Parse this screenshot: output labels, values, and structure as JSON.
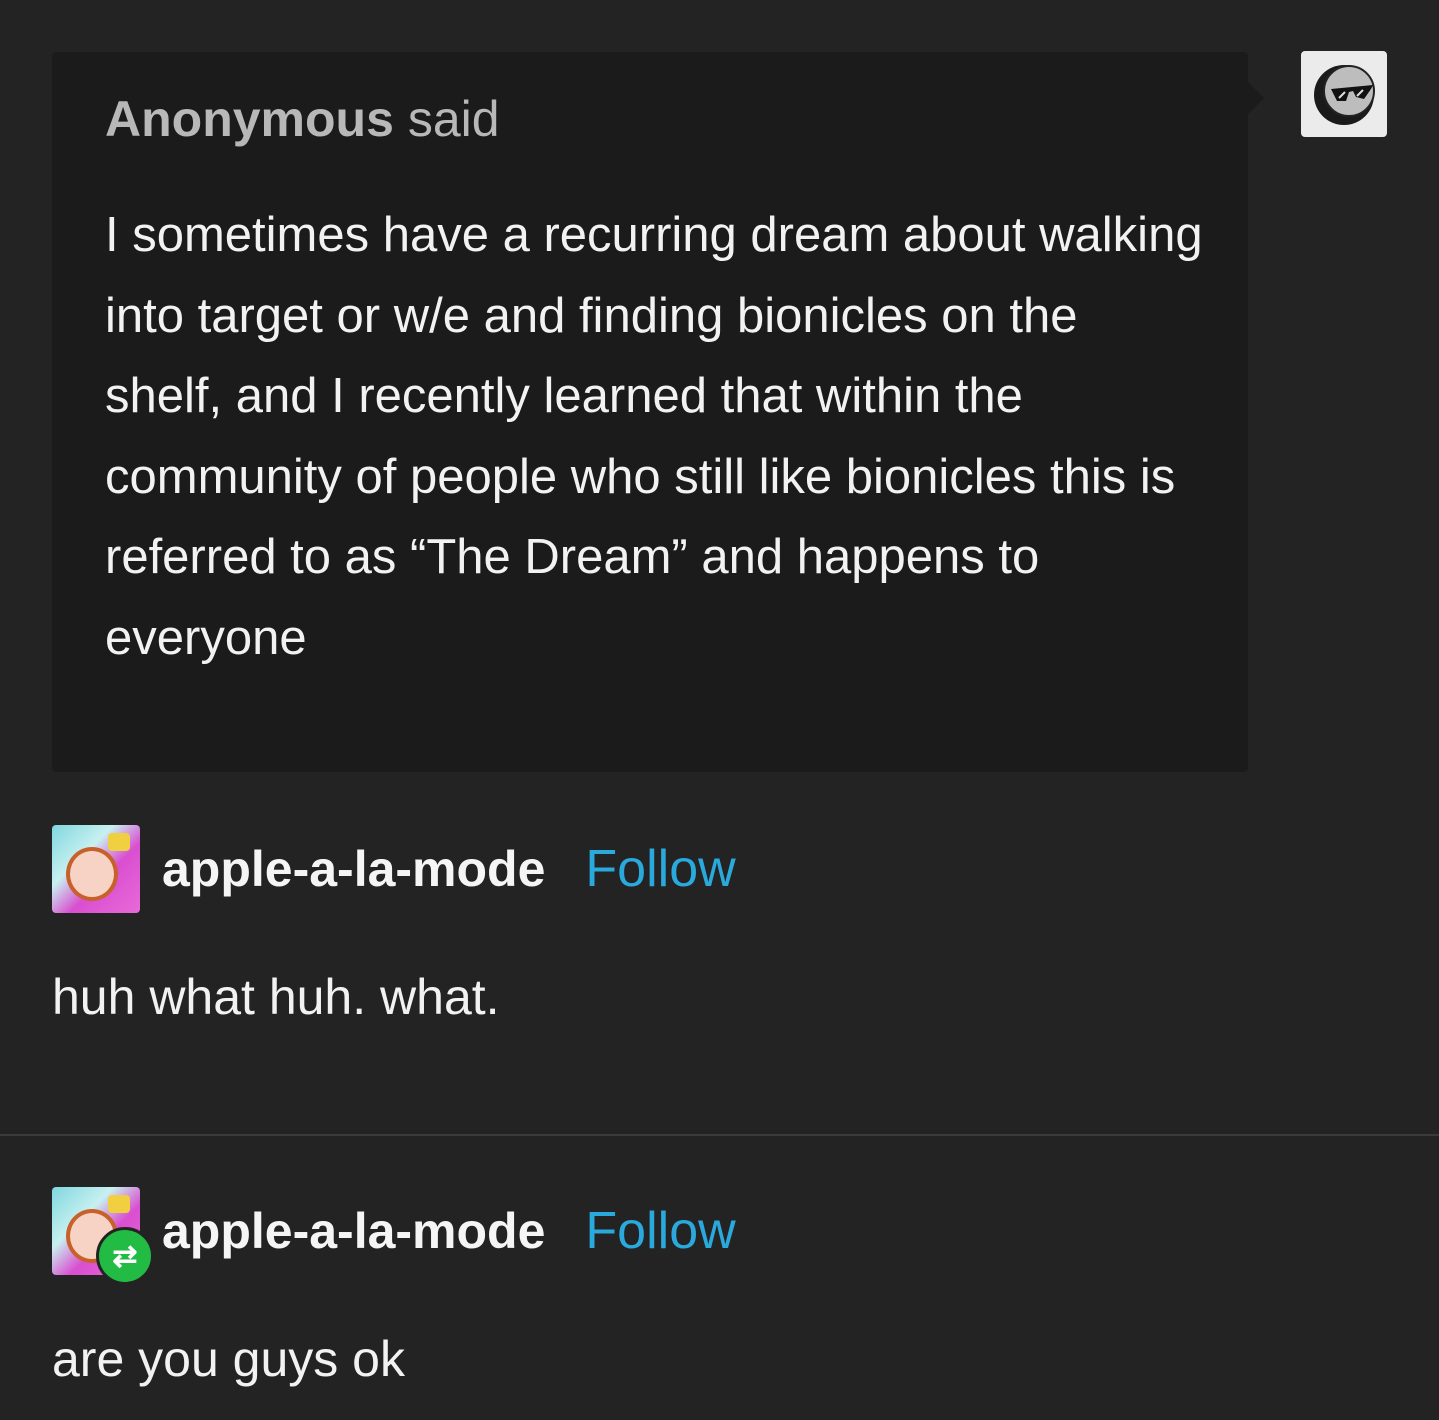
{
  "ask": {
    "asker_name": "Anonymous",
    "asker_suffix": "said",
    "question": "I sometimes have a recurring dream about walking into target or w/e and finding bionicles on the shelf, and I recently learned that within the community of people who still like bionicles this is referred to as “The Dream” and happens to everyone",
    "avatar_icon": "sunglasses-moon-icon"
  },
  "posts": [
    {
      "username": "apple-a-la-mode",
      "follow_label": "Follow",
      "text": "huh what huh. what.",
      "reblog": false
    },
    {
      "username": "apple-a-la-mode",
      "follow_label": "Follow",
      "text": "are you guys ok",
      "reblog": true
    }
  ],
  "colors": {
    "background": "#232323",
    "ask_box": "#1b1b1b",
    "follow": "#2aa9dc",
    "reblog_badge": "#22bb44"
  }
}
